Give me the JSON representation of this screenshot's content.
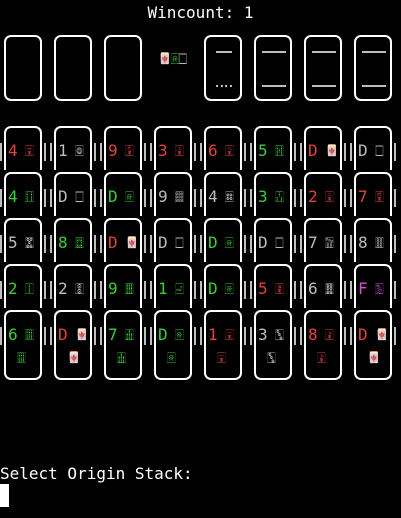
{
  "header": {
    "wincount": "Wincount: 1"
  },
  "free_cells": [
    {
      "state": "empty"
    },
    {
      "state": "empty"
    },
    {
      "state": "empty"
    }
  ],
  "dragon_indicator": [
    {
      "glyph": "🀄",
      "color": "#e0443e"
    },
    {
      "glyph": "🀅",
      "color": "#38d037"
    },
    {
      "glyph": "🀆",
      "color": "#bdbdbd"
    }
  ],
  "foundations": [
    {
      "pattern": "sparse"
    },
    {
      "pattern": "full"
    },
    {
      "pattern": "full"
    },
    {
      "pattern": "full"
    }
  ],
  "tableau": [
    [
      {
        "value": "4",
        "suit": "🀌",
        "color": "#e0443e"
      },
      {
        "value": "4",
        "suit": "🀓",
        "color": "#38d037"
      },
      {
        "value": "5",
        "suit": "🀝",
        "color": "#bdbdbd"
      },
      {
        "value": "2",
        "suit": "🀑",
        "color": "#38d037"
      },
      {
        "value": "6",
        "suit": "🀕",
        "color": "#38d037"
      }
    ],
    [
      {
        "value": "1",
        "suit": "🀙",
        "color": "#bdbdbd"
      },
      {
        "value": "D",
        "suit": "🀆",
        "color": "#bdbdbd"
      },
      {
        "value": "8",
        "suit": "🀗",
        "color": "#38d037"
      },
      {
        "value": "2",
        "suit": "🀚",
        "color": "#bdbdbd"
      },
      {
        "value": "D",
        "suit": "🀄",
        "color": "#e0443e"
      }
    ],
    [
      {
        "value": "9",
        "suit": "🀏",
        "color": "#e0443e"
      },
      {
        "value": "D",
        "suit": "🀅",
        "color": "#38d037"
      },
      {
        "value": "D",
        "suit": "🀄",
        "color": "#e0443e"
      },
      {
        "value": "9",
        "suit": "🀘",
        "color": "#38d037"
      },
      {
        "value": "7",
        "suit": "🀖",
        "color": "#38d037"
      }
    ],
    [
      {
        "value": "3",
        "suit": "🀉",
        "color": "#e0443e"
      },
      {
        "value": "9",
        "suit": "🀡",
        "color": "#bdbdbd"
      },
      {
        "value": "D",
        "suit": "🀆",
        "color": "#bdbdbd"
      },
      {
        "value": "1",
        "suit": "🀐",
        "color": "#38d037"
      },
      {
        "value": "D",
        "suit": "🀅",
        "color": "#38d037"
      }
    ],
    [
      {
        "value": "6",
        "suit": "🀎",
        "color": "#e0443e"
      },
      {
        "value": "4",
        "suit": "🀜",
        "color": "#bdbdbd"
      },
      {
        "value": "D",
        "suit": "🀅",
        "color": "#38d037"
      },
      {
        "value": "D",
        "suit": "🀅",
        "color": "#38d037"
      },
      {
        "value": "1",
        "suit": "🀇",
        "color": "#e0443e"
      }
    ],
    [
      {
        "value": "5",
        "suit": "🀔",
        "color": "#38d037"
      },
      {
        "value": "3",
        "suit": "🀒",
        "color": "#38d037"
      },
      {
        "value": "D",
        "suit": "🀆",
        "color": "#bdbdbd"
      },
      {
        "value": "5",
        "suit": "🀋",
        "color": "#e0443e"
      },
      {
        "value": "3",
        "suit": "🀛",
        "color": "#bdbdbd"
      }
    ],
    [
      {
        "value": "D",
        "suit": "🀄",
        "color": "#e0443e"
      },
      {
        "value": "2",
        "suit": "🀈",
        "color": "#e0443e"
      },
      {
        "value": "7",
        "suit": "🀟",
        "color": "#bdbdbd"
      },
      {
        "value": "6",
        "suit": "🀞",
        "color": "#bdbdbd"
      },
      {
        "value": "8",
        "suit": "🀍",
        "color": "#e0443e"
      }
    ],
    [
      {
        "value": "D",
        "suit": "🀆",
        "color": "#bdbdbd"
      },
      {
        "value": "7",
        "suit": "🀊",
        "color": "#e0443e"
      },
      {
        "value": "8",
        "suit": "🀠",
        "color": "#bdbdbd"
      },
      {
        "value": "F",
        "suit": "🀢",
        "color": "#d04dd9"
      },
      {
        "value": "D",
        "suit": "🀄",
        "color": "#e0443e"
      }
    ]
  ],
  "footer": {
    "prompt": "Select Origin Stack:"
  }
}
